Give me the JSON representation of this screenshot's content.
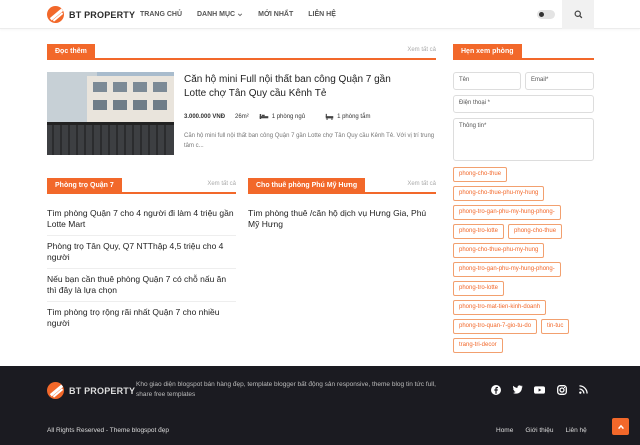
{
  "brand": {
    "name": "BT PROPERTY"
  },
  "nav": {
    "items": [
      {
        "label": "TRANG CHỦ"
      },
      {
        "label": "DANH MỤC"
      },
      {
        "label": "MỚI NHẤT"
      },
      {
        "label": "LIÊN HỆ"
      }
    ]
  },
  "featured": {
    "header": "Đọc thêm",
    "more": "Xem tất cả",
    "title": "Căn hộ mini Full nội thất ban công Quận 7 gần Lotte chợ Tân Quy cầu Kênh Tẻ",
    "price": "3.000.000 VNĐ",
    "area": "26m²",
    "bedrooms": "1 phòng ngủ",
    "bathrooms": "1 phòng tắm",
    "description": "Căn hộ mini full nội thất ban công Quận 7 gần Lotte chợ Tân Quy cầu Kênh Tẻ. Với vị trí trung tâm c..."
  },
  "section_left": {
    "header": "Phòng trọ Quận 7",
    "more": "Xem tất cả",
    "posts": [
      {
        "title": "Tìm phòng Quận 7 cho 4 người đi làm 4 triệu gần Lotte Mart"
      },
      {
        "title": "Phòng trọ Tân Quy, Q7 NTThập 4,5 triệu cho 4 người"
      },
      {
        "title": "Nếu bạn cần thuê phòng Quận 7 có chỗ nấu ăn thì đây là lựa chọn"
      },
      {
        "title": "Tìm phòng trọ rộng rãi nhất Quận 7 cho nhiều người"
      }
    ]
  },
  "section_right": {
    "header": "Cho thuê phòng Phú Mỹ Hưng",
    "more": "Xem tất cả",
    "posts": [
      {
        "title": "Tìm phòng thuê /căn hộ dịch vụ Hưng Gia, Phú Mỹ Hưng"
      }
    ]
  },
  "sidebar": {
    "header": "Hẹn xem phòng",
    "name_placeholder": "Tên",
    "email_placeholder": "Email*",
    "phone_placeholder": "Điện thoại *",
    "message_placeholder": "Thông tin*",
    "tags": [
      "phong-cho-thue",
      "phong-cho-thue-phu-my-hung",
      "phong-tro-gan-phu-my-hung-phong-",
      "phong-tro-lotte",
      "phong-cho-thue",
      "phong-cho-thue-phu-my-hung",
      "phong-tro-gan-phu-my-hung-phong-",
      "phong-tro-lotte",
      "phong-tro-mat-tien-kinh-doanh",
      "phong-tro-quan-7-gio-tu-do",
      "tin-tuc",
      "trang-tri-decor"
    ]
  },
  "footer": {
    "about": "Kho giao diện blogspot bán hàng đẹp, template blogger bất động sản responsive, theme blog tin tức full, share free templates",
    "copyright": "All Rights Reserved - Theme blogspot đẹp",
    "links": [
      {
        "label": "Home"
      },
      {
        "label": "Giới thiệu"
      },
      {
        "label": "Liên hệ"
      }
    ],
    "socials": [
      "facebook-icon",
      "twitter-icon",
      "youtube-icon",
      "instagram-icon",
      "rss-icon"
    ]
  },
  "colors": {
    "accent": "#f2682a",
    "footer_bg": "#1b1b21"
  }
}
